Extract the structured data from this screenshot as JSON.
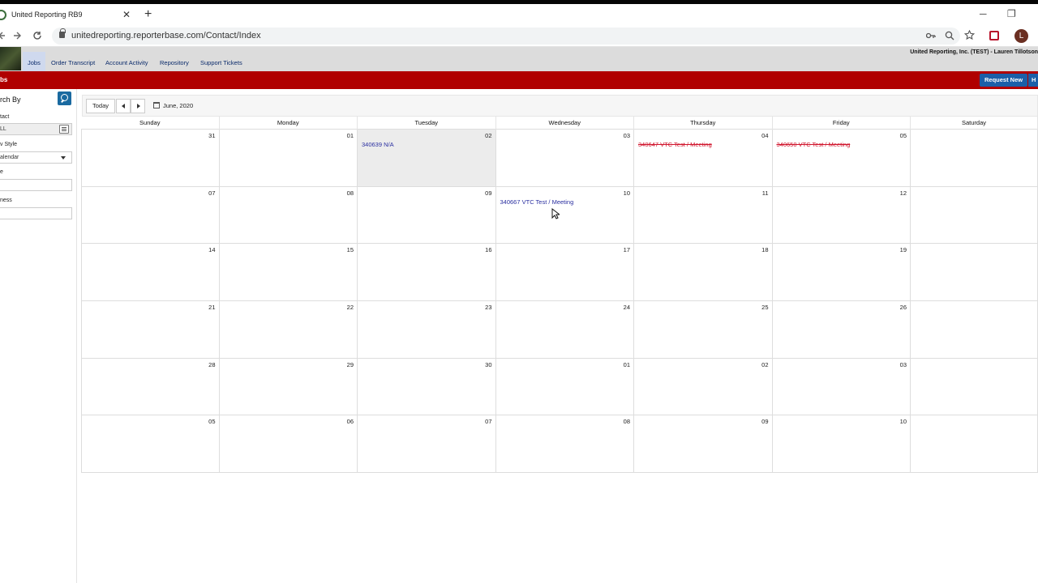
{
  "browser": {
    "tab_title": "United Reporting RB9",
    "tab_close": "✕",
    "new_tab": "+",
    "url": "unitedreporting.reporterbase.com/Contact/Index",
    "minimize": "─",
    "restore": "❐",
    "profile_initial": "L",
    "icons": {
      "back": "back-arrow-icon",
      "forward": "forward-arrow-icon",
      "reload": "reload-icon",
      "key": "key-icon",
      "zoom": "zoom-icon",
      "bookmark": "star-icon",
      "extension": "extension-icon"
    }
  },
  "app": {
    "nav": [
      {
        "label": "Jobs",
        "active": true
      },
      {
        "label": "Order Transcript"
      },
      {
        "label": "Account Activity"
      },
      {
        "label": "Repository"
      },
      {
        "label": "Support Tickets"
      }
    ],
    "company_user": "United Reporting, Inc. (TEST) - Lauren Tillotson",
    "page_title": "bs",
    "request_new": "Request New",
    "help_button": "H",
    "brand_red": "#b00000",
    "brand_blue": "#1b5fa8"
  },
  "sidebar": {
    "title": "rch By",
    "contact_label": "tact",
    "contact_value": "LL",
    "view_style_label": "v Style",
    "view_style_value": "alendar",
    "field3_label": "e",
    "field4_label": "ness"
  },
  "toolbar": {
    "today": "Today",
    "month": "June, 2020"
  },
  "calendar": {
    "weekdays": [
      "Sunday",
      "Monday",
      "Tuesday",
      "Wednesday",
      "Thursday",
      "Friday",
      "Saturday"
    ],
    "weeks": [
      [
        "31",
        "01",
        "02",
        "03",
        "04",
        "05",
        ""
      ],
      [
        "07",
        "08",
        "09",
        "10",
        "11",
        "12",
        ""
      ],
      [
        "14",
        "15",
        "16",
        "17",
        "18",
        "19",
        ""
      ],
      [
        "21",
        "22",
        "23",
        "24",
        "25",
        "26",
        ""
      ],
      [
        "28",
        "29",
        "30",
        "01",
        "02",
        "03",
        ""
      ],
      [
        "05",
        "06",
        "07",
        "08",
        "09",
        "10",
        ""
      ]
    ],
    "events": {
      "w0d2": {
        "text": "340639  N/A",
        "status": "normal"
      },
      "w0d4": {
        "text": "340647  VTC Test / Meeting",
        "status": "cancelled"
      },
      "w0d5": {
        "text": "340650  VTC Test / Meeting",
        "status": "cancelled"
      },
      "w1d3": {
        "text": "340667  VTC Test / Meeting",
        "status": "normal"
      }
    }
  }
}
